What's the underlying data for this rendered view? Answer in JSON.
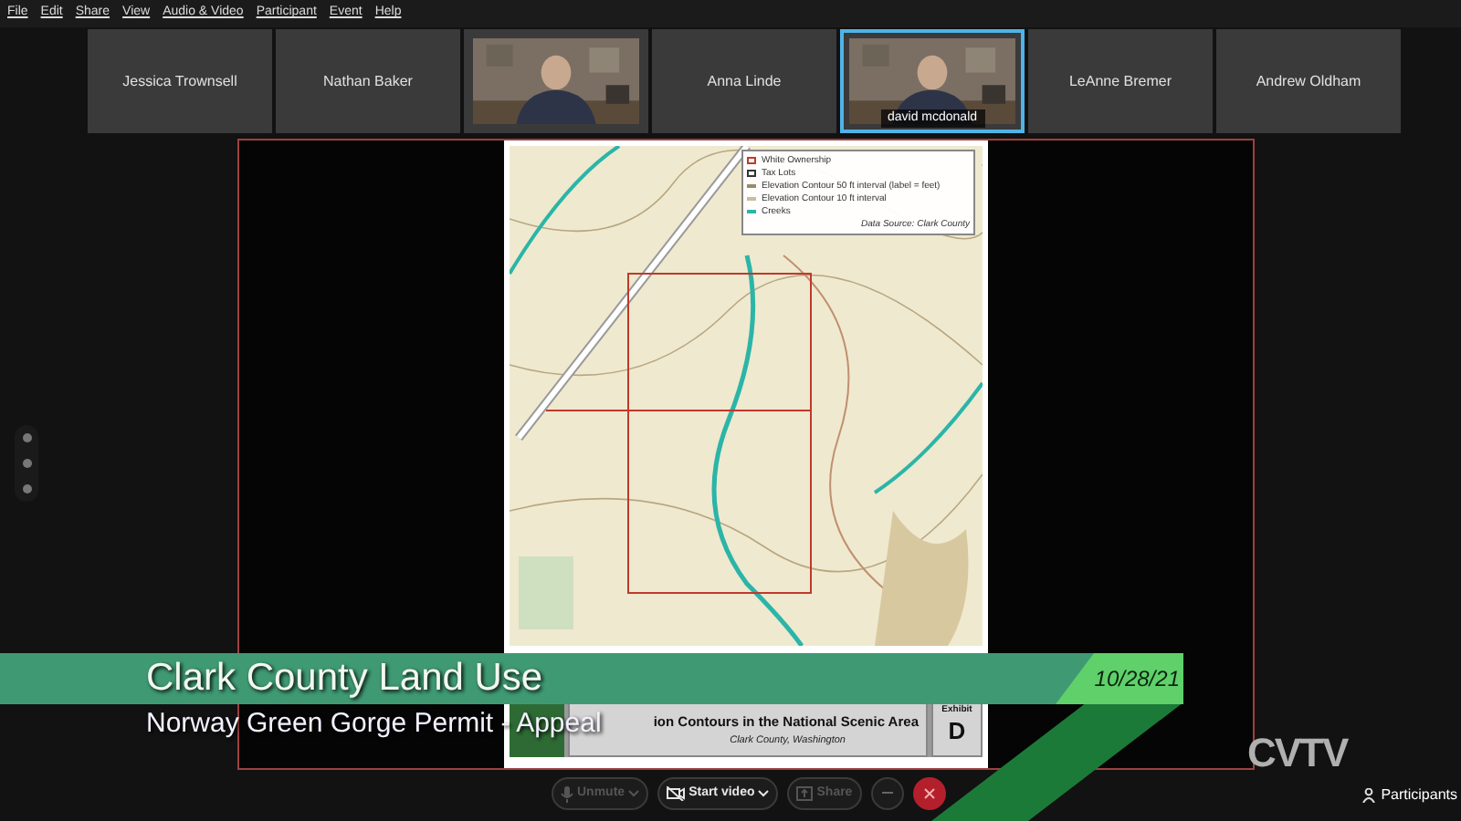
{
  "menu": [
    "File",
    "Edit",
    "Share",
    "View",
    "Audio & Video",
    "Participant",
    "Event",
    "Help"
  ],
  "participants": [
    {
      "kind": "name",
      "name": "Jessica Trownsell",
      "selected": false
    },
    {
      "kind": "name",
      "name": "Nathan Baker",
      "selected": false
    },
    {
      "kind": "video",
      "selected": false
    },
    {
      "kind": "name",
      "name": "Anna Linde",
      "selected": false
    },
    {
      "kind": "video",
      "name": "david mcdonald",
      "selected": true
    },
    {
      "kind": "name",
      "name": "LeAnne Bremer",
      "selected": false
    },
    {
      "kind": "name",
      "name": "Andrew Oldham",
      "selected": false
    }
  ],
  "shared_document": {
    "legend": [
      {
        "kind": "box",
        "label": "White Ownership",
        "color": "#c0392b"
      },
      {
        "kind": "box",
        "label": "Tax Lots",
        "color": "#333333"
      },
      {
        "kind": "line",
        "label": "Elevation Contour 50 ft interval (label = feet)",
        "color": "#9a8a6a"
      },
      {
        "kind": "line",
        "label": "Elevation Contour 10 ft interval",
        "color": "#c8bca0"
      },
      {
        "kind": "line",
        "label": "Creeks",
        "color": "#2bb5a8"
      }
    ],
    "data_source": "Data Source: Clark County",
    "title": "ion Contours in the National Scenic Area",
    "subtitle": "Clark County, Washington",
    "exhibit_label": "Exhibit",
    "exhibit": "D"
  },
  "toolbar": [
    {
      "kind": "mic",
      "label": "Unmute",
      "disabled": true
    },
    {
      "kind": "camera",
      "label": "Start video",
      "disabled": false
    },
    {
      "kind": "share",
      "label": "Share",
      "disabled": true
    }
  ],
  "participants_button": "Participants",
  "banner": {
    "title": "Clark County Land Use",
    "subtitle": "Norway Green Gorge Permit - Appeal",
    "date": "10/28/21"
  },
  "logo": "CVTV"
}
